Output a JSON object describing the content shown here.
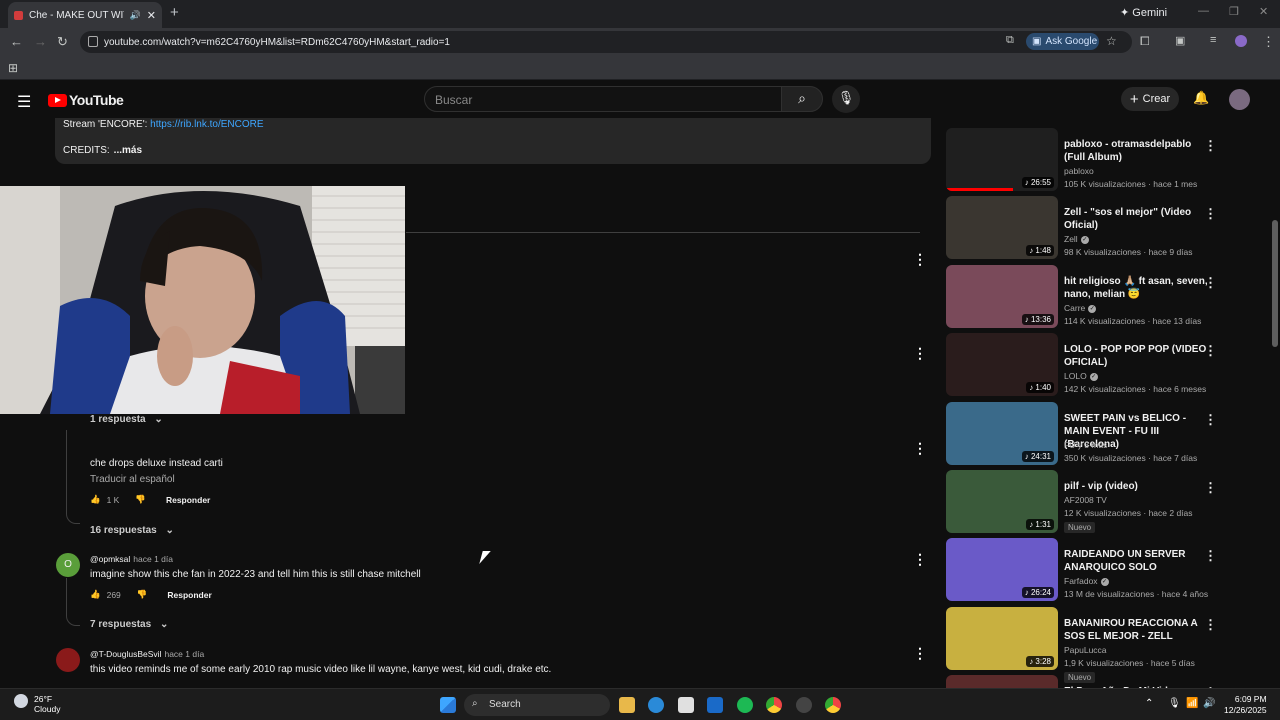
{
  "browser": {
    "tab_title": "Che - MAKE OUT WITH MY",
    "tab_sound_icon": "speaker-icon",
    "gemini_label": "Gemini",
    "url": "youtube.com/watch?v=m62C4760yHM&list=RDm62C4760yHM&start_radio=1",
    "ask_google_label": "Ask Google"
  },
  "yt": {
    "logo_text": "YouTube",
    "search_placeholder": "Buscar",
    "create_label": "Crear"
  },
  "description": {
    "stream_label": "Stream 'ENCORE':",
    "stream_link": "https://rib.lnk.to/ENCORE",
    "credits_label": "CREDITS:",
    "more_label": "...más"
  },
  "comments": [
    {
      "replies_label": "1 respuesta",
      "text": "che drops deluxe instead carti",
      "translate": "Traducir al español",
      "likes": "1 K",
      "reply_label": "Responder",
      "sub_replies_label": "16 respuestas"
    },
    {
      "handle": "@opmksal",
      "ago": "hace 1 día",
      "text": "imagine show this che fan in 2022-23 and tell him this is still chase mitchell",
      "likes": "269",
      "reply_label": "Responder",
      "sub_replies_label": "7 respuestas",
      "avatar_letter": "O",
      "avatar_color": "#5a9e3a"
    },
    {
      "handle": "@T-DouglusBeSvil",
      "ago": "hace 1 día",
      "text": "this video reminds me of some early 2010 rap music video like lil wayne, kanye west, kid cudi, drake etc.",
      "avatar_color": "#8a1a1a"
    }
  ],
  "sidebar_videos": [
    {
      "title": "pabloxo - otramasdelpablo (Full Album)",
      "channel": "pabloxo",
      "meta": "105 K visualizaciones · hace 1 mes",
      "duration": "26:55",
      "progress": 0.6,
      "thumb_color": "#1f1f1f"
    },
    {
      "title": "Zell - \"sos el mejor\" (Video Oficial)",
      "channel": "Zell",
      "verified": true,
      "meta": "98 K visualizaciones · hace 9 días",
      "duration": "1:48",
      "thumb_color": "#3a3630"
    },
    {
      "title": "hit religioso 🙏🏼 ft asan, seven, nano, melian 😇",
      "channel": "Carre",
      "verified": true,
      "meta": "114 K visualizaciones · hace 13 días",
      "duration": "13:36",
      "thumb_color": "#7a4a5a"
    },
    {
      "title": "LOLO - POP POP POP (VIDEO OFICIAL)",
      "channel": "LOLO",
      "verified": true,
      "meta": "142 K visualizaciones · hace 6 meses",
      "duration": "1:40",
      "thumb_color": "#2a1c1c"
    },
    {
      "title": "SWEET PAIN vs BELICO - MAIN EVENT - FU III (Barcelona)",
      "channel": "FU y 3 más",
      "meta": "350 K visualizaciones · hace 7 días",
      "duration": "24:31",
      "thumb_color": "#3a6a8a"
    },
    {
      "title": "pilf - vip (video)",
      "channel": "AF2008 TV",
      "meta": "12 K visualizaciones · hace 2 días",
      "duration": "1:31",
      "badge": "Nuevo",
      "thumb_color": "#3a5a3a"
    },
    {
      "title": "RAIDEANDO UN SERVER ANARQUICO SOLO",
      "channel": "Farfadox",
      "verified": true,
      "meta": "13 M de visualizaciones · hace 4 años",
      "duration": "26:24",
      "thumb_color": "#6a5ac8"
    },
    {
      "title": "BANANIROU REACCIONA A SOS EL MEJOR - ZELL",
      "channel": "PapuLucca",
      "meta": "1,9 K visualizaciones · hace 5 días",
      "duration": "3:28",
      "badge": "Nuevo",
      "thumb_color": "#c8b040"
    },
    {
      "title": "El Peor Año De Mi Vida",
      "thumb_color": "#5a2a2a"
    }
  ],
  "taskbar": {
    "temp": "26°F",
    "condition": "Cloudy",
    "search_label": "Search",
    "time": "6:09 PM",
    "date": "12/26/2025"
  }
}
